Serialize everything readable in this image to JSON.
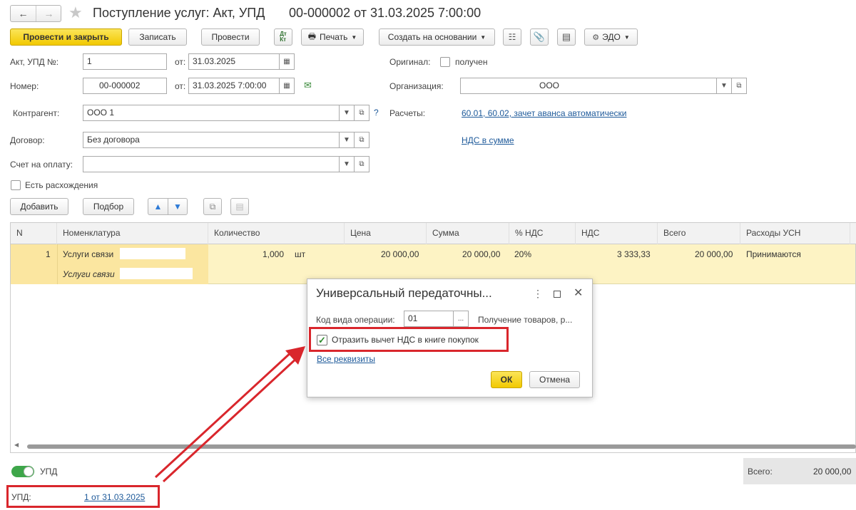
{
  "window": {
    "title": "Поступление услуг: Акт, УПД",
    "doc_number": "00-000002 от 31.03.2025 7:00:00"
  },
  "toolbar": {
    "post_close": "Провести и закрыть",
    "save": "Записать",
    "post": "Провести",
    "dt_kt": "Дт Кт",
    "print": "Печать",
    "create_based": "Создать на основании",
    "edo": "ЭДО"
  },
  "form": {
    "act_label": "Акт, УПД №:",
    "act_value": "1",
    "from_label": "от:",
    "act_date": "31.03.2025",
    "number_label": "Номер:",
    "number_value": "00-000002",
    "number_date": "31.03.2025  7:00:00",
    "original_label": "Оригинал:",
    "original_check_label": "получен",
    "org_label": "Организация:",
    "org_value": "ООО",
    "counterparty_label": "Контрагент:",
    "counterparty_value": "ООО 1",
    "help": "?",
    "settlements_label": "Расчеты:",
    "settlements_link": "60.01, 60.02, зачет аванса автоматически",
    "contract_label": "Договор:",
    "contract_value": "Без договора",
    "vat_link": "НДС в сумме",
    "invoice_label": "Счет на оплату:",
    "invoice_value": "",
    "discrepancy_label": "Есть расхождения"
  },
  "table_toolbar": {
    "add": "Добавить",
    "pick": "Подбор"
  },
  "table": {
    "columns": [
      "N",
      "Номенклатура",
      "Количество",
      "Цена",
      "Сумма",
      "% НДС",
      "НДС",
      "Всего",
      "Расходы УСН"
    ],
    "row": {
      "n": "1",
      "item": "Услуги связи",
      "item_sub": "Услуги связи",
      "qty": "1,000",
      "unit": "шт",
      "price": "20 000,00",
      "sum": "20 000,00",
      "vat_rate": "20%",
      "vat": "3 333,33",
      "total": "20 000,00",
      "usn": "Принимаются"
    }
  },
  "dialog": {
    "title": "Универсальный передаточны...",
    "op_code_label": "Код вида операции:",
    "op_code_value": "01",
    "op_code_desc": "Получение товаров, р...",
    "reflect_label": "Отразить вычет НДС в книге покупок",
    "all_details": "Все реквизиты",
    "ok": "ОК",
    "cancel": "Отмена"
  },
  "footer": {
    "upd_toggle_label": "УПД",
    "upd_label": "УПД:",
    "upd_link": "1 от 31.03.2025",
    "total_label": "Всего:",
    "total_value": "20 000,00"
  },
  "colors": {
    "accent_yellow": "#f2c900",
    "highlight_red": "#d9262c",
    "link_blue": "#1e5a9a",
    "row_highlight": "#fdf3c4",
    "toggle_green": "#3ea64a"
  }
}
